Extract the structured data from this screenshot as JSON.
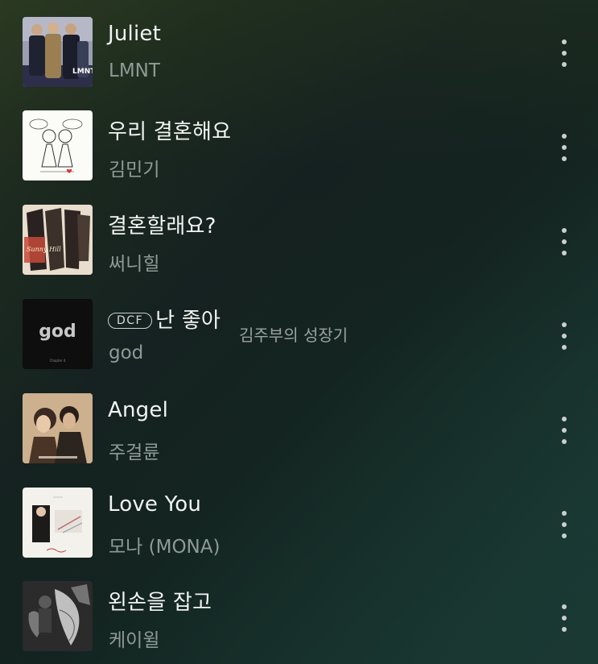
{
  "tracks": [
    {
      "title": "Juliet",
      "artist": "LMNT",
      "badge": "",
      "album_art": "lmnt-juliet-cover"
    },
    {
      "title": "우리 결혼해요",
      "artist": "김민기",
      "badge": "",
      "album_art": "wedding-drawing-cover"
    },
    {
      "title": "결혼할래요?",
      "artist": "써니힐",
      "badge": "",
      "album_art": "sunny-hill-cover"
    },
    {
      "title": "난 좋아",
      "artist": "god",
      "badge": "DCF",
      "note": "김주부의 성장기",
      "album_art": "god-chapter4-cover"
    },
    {
      "title": "Angel",
      "artist": "주걸륜",
      "badge": "",
      "album_art": "jay-chou-angel-cover"
    },
    {
      "title": "Love You",
      "artist": "모나 (MONA)",
      "badge": "",
      "album_art": "mona-love-you-cover"
    },
    {
      "title": "왼손을 잡고",
      "artist": "케이윌",
      "badge": "",
      "album_art": "k-will-cover"
    }
  ],
  "album_labels": {
    "lmnt": "LMNT",
    "god": "god",
    "god_sub": "Chapter 4",
    "sunny": "Sunny Hill"
  },
  "more_icon": "more-vertical-icon",
  "colors": {
    "title": "#f2f4f2",
    "artist": "#8f9a96",
    "accent_heart": "#d9363b"
  }
}
